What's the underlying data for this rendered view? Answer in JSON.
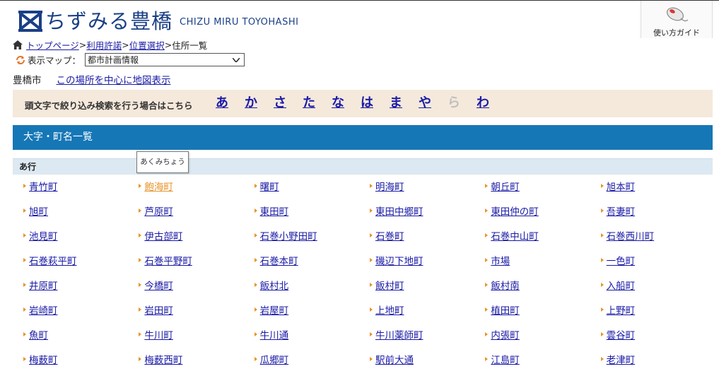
{
  "header": {
    "logo_text": "ちずみる豊橋",
    "logo_sub": "CHIZU MIRU TOYOHASHI",
    "guide_label": "使い方ガイド"
  },
  "breadcrumb": {
    "items": [
      "トップページ",
      "利用許諾",
      "位置選択"
    ],
    "separator": ">",
    "current": "住所一覧"
  },
  "map_select": {
    "label": "表示マップ：",
    "value": "都市計画情報"
  },
  "city": {
    "name": "豊橋市",
    "link": "この場所を中心に地図表示"
  },
  "kana_filter": {
    "label": "頭文字で絞り込み検索を行う場合はこちら",
    "letters": [
      {
        "char": "あ",
        "enabled": true
      },
      {
        "char": "か",
        "enabled": true
      },
      {
        "char": "さ",
        "enabled": true
      },
      {
        "char": "た",
        "enabled": true
      },
      {
        "char": "な",
        "enabled": true
      },
      {
        "char": "は",
        "enabled": true
      },
      {
        "char": "ま",
        "enabled": true
      },
      {
        "char": "や",
        "enabled": true
      },
      {
        "char": "ら",
        "enabled": false
      },
      {
        "char": "わ",
        "enabled": true
      }
    ]
  },
  "section_title": "大字・町名一覧",
  "group_title": "あ行",
  "tooltip": "あくみちょう",
  "towns": [
    [
      "青竹町",
      "飽海町",
      "曙町",
      "明海町",
      "朝丘町",
      "旭本町"
    ],
    [
      "旭町",
      "芦原町",
      "東田町",
      "東田中郷町",
      "東田仲の町",
      "吾妻町"
    ],
    [
      "池見町",
      "伊古部町",
      "石巻小野田町",
      "石巻町",
      "石巻中山町",
      "石巻西川町"
    ],
    [
      "石巻萩平町",
      "石巻平野町",
      "石巻本町",
      "磯辺下地町",
      "市場",
      "一色町"
    ],
    [
      "井原町",
      "今橋町",
      "飯村北",
      "飯村町",
      "飯村南",
      "入船町"
    ],
    [
      "岩崎町",
      "岩田町",
      "岩屋町",
      "上地町",
      "植田町",
      "上野町"
    ],
    [
      "魚町",
      "牛川町",
      "牛川通",
      "牛川薬師町",
      "内張町",
      "雲谷町"
    ],
    [
      "梅薮町",
      "梅薮西町",
      "瓜郷町",
      "駅前大通",
      "江島町",
      "老津町"
    ]
  ],
  "hovered_town": "飽海町",
  "colors": {
    "brand": "#1a3f86",
    "section_bg": "#1677b6",
    "kana_bg": "#f5e9dc",
    "group_bg": "#dde9f2",
    "link": "#1a1aa6",
    "hover_link": "#e8932a"
  }
}
